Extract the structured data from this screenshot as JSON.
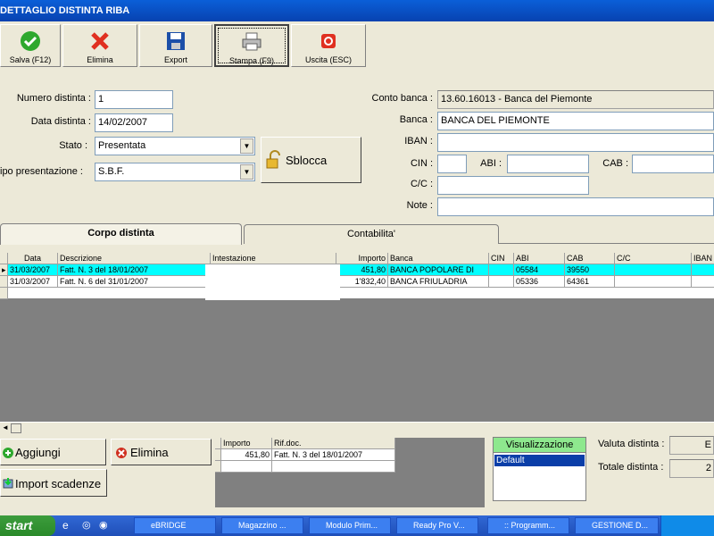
{
  "window": {
    "title": "DETTAGLIO DISTINTA RIBA"
  },
  "toolbar": {
    "save": "Salva (F12)",
    "delete": "Elimina",
    "export": "Export",
    "print": "Stampa (F9)",
    "exit": "Uscita (ESC)"
  },
  "form": {
    "numero_label": "Numero distinta :",
    "numero_value": "1",
    "data_label": "Data distinta :",
    "data_value": "14/02/2007",
    "stato_label": "Stato :",
    "stato_value": "Presentata",
    "tipo_label": "ipo presentazione :",
    "tipo_value": "S.B.F.",
    "sblocca": "Sblocca",
    "conto_label": "Conto banca :",
    "conto_value": "13.60.16013 - Banca del Piemonte",
    "banca_label": "Banca :",
    "banca_value": "BANCA DEL PIEMONTE",
    "iban_label": "IBAN :",
    "iban_value": "",
    "cin_label": "CIN :",
    "abi_label": "ABI :",
    "cab_label": "CAB :",
    "cc_label": "C/C :",
    "note_label": "Note :"
  },
  "tabs": {
    "corpo": "Corpo distinta",
    "contabilita": "Contabilita'"
  },
  "grid": {
    "headers": [
      "Data",
      "Descrizione",
      "Intestazione",
      "Importo",
      "Banca",
      "CIN",
      "ABI",
      "CAB",
      "C/C",
      "IBAN"
    ],
    "rows": [
      {
        "data": "31/03/2007",
        "descrizione": "Fatt. N. 3 del 18/01/2007",
        "intestazione": "",
        "importo": "451,80",
        "banca": "BANCA POPOLARE DI",
        "cin": "",
        "abi": "05584",
        "cab": "39550",
        "cc": "",
        "iban": ""
      },
      {
        "data": "31/03/2007",
        "descrizione": "Fatt. N. 6 del 31/01/2007",
        "intestazione": "",
        "importo": "1'832,40",
        "banca": "BANCA FRIULADRIA",
        "cin": "",
        "abi": "05336",
        "cab": "64361",
        "cc": "",
        "iban": ""
      }
    ]
  },
  "bottom": {
    "aggiungi": "Aggiungi",
    "elimina": "Elimina",
    "import": "Import scadenze",
    "sub_headers": [
      "Importo",
      "Rif.doc."
    ],
    "sub_row": {
      "importo": "451,80",
      "rif": "Fatt. N. 3 del 18/01/2007"
    },
    "visual_title": "Visualizzazione",
    "visual_item": "Default",
    "valuta_label": "Valuta distinta :",
    "valuta_value": "E",
    "totale_label": "Totale distinta :",
    "totale_value": "2"
  },
  "taskbar": {
    "start": "start",
    "items": [
      "eBRIDGE",
      "Magazzino ...",
      "Modulo Prim...",
      "Ready Pro V...",
      ":: Programm...",
      "GESTIONE D..."
    ]
  }
}
